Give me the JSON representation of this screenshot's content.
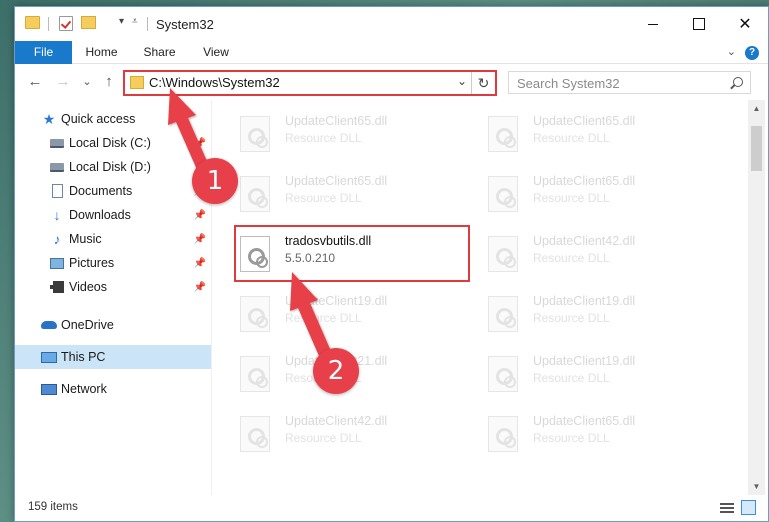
{
  "window": {
    "title": "System32",
    "controls": {
      "minimize": "",
      "maximize": "",
      "close": "✕"
    }
  },
  "quick_access_toolbar": {
    "icons": [
      "folder-icon",
      "properties-check-icon",
      "new-folder-icon",
      "properties-list-icon",
      "customize-dropdown-icon"
    ]
  },
  "ribbon": {
    "tabs": [
      "File",
      "Home",
      "Share",
      "View"
    ],
    "help": "?",
    "collapse": "⌄"
  },
  "navigation": {
    "back": "←",
    "forward": "→",
    "recent": "⌄",
    "up": "↑",
    "address": "C:\\Windows\\System32",
    "address_dropdown": "⌄",
    "refresh": "↻",
    "search_placeholder": "Search System32"
  },
  "sidebar": {
    "items": [
      {
        "label": "Quick access",
        "icon": "star-icon",
        "pinned": false
      },
      {
        "label": "Local Disk (C:)",
        "icon": "drive-icon",
        "pinned": true
      },
      {
        "label": "Local Disk (D:)",
        "icon": "drive-icon",
        "pinned": true
      },
      {
        "label": "Documents",
        "icon": "documents-icon",
        "pinned": true
      },
      {
        "label": "Downloads",
        "icon": "downloads-icon",
        "pinned": true
      },
      {
        "label": "Music",
        "icon": "music-icon",
        "pinned": true
      },
      {
        "label": "Pictures",
        "icon": "pictures-icon",
        "pinned": true
      },
      {
        "label": "Videos",
        "icon": "videos-icon",
        "pinned": true
      },
      {
        "label": "OneDrive",
        "icon": "onedrive-icon",
        "pinned": false
      },
      {
        "label": "This PC",
        "icon": "this-pc-icon",
        "pinned": false,
        "selected": true
      },
      {
        "label": "Network",
        "icon": "network-icon",
        "pinned": false
      }
    ],
    "pin_glyph": "📌"
  },
  "files": {
    "left_column": [
      {
        "name": "UpdateClient65.dll",
        "type": "Resource DLL"
      },
      {
        "name": "UpdateClient65.dll",
        "type": "Resource DLL"
      },
      {
        "name": "tradosvbutils.dll",
        "type": "5.5.0.210",
        "highlighted": true
      },
      {
        "name": "UpdateClient19.dll",
        "type": "Resource DLL"
      },
      {
        "name": "UpdateClient21.dll",
        "type": "Resource DLL"
      },
      {
        "name": "UpdateClient42.dll",
        "type": "Resource DLL"
      }
    ],
    "right_column": [
      {
        "name": "UpdateClient65.dll",
        "type": "Resource DLL"
      },
      {
        "name": "UpdateClient65.dll",
        "type": "Resource DLL"
      },
      {
        "name": "UpdateClient42.dll",
        "type": "Resource DLL"
      },
      {
        "name": "UpdateClient19.dll",
        "type": "Resource DLL"
      },
      {
        "name": "UpdateClient19.dll",
        "type": "Resource DLL"
      },
      {
        "name": "UpdateClient65.dll",
        "type": "Resource DLL"
      }
    ]
  },
  "status": {
    "item_count": "159 items"
  },
  "annotations": {
    "step1": "1",
    "step2": "2",
    "color": "#e8404a"
  },
  "colors": {
    "accent": "#1979ca",
    "highlight_border": "#e0393e",
    "selected_bg": "#cce4f7"
  }
}
